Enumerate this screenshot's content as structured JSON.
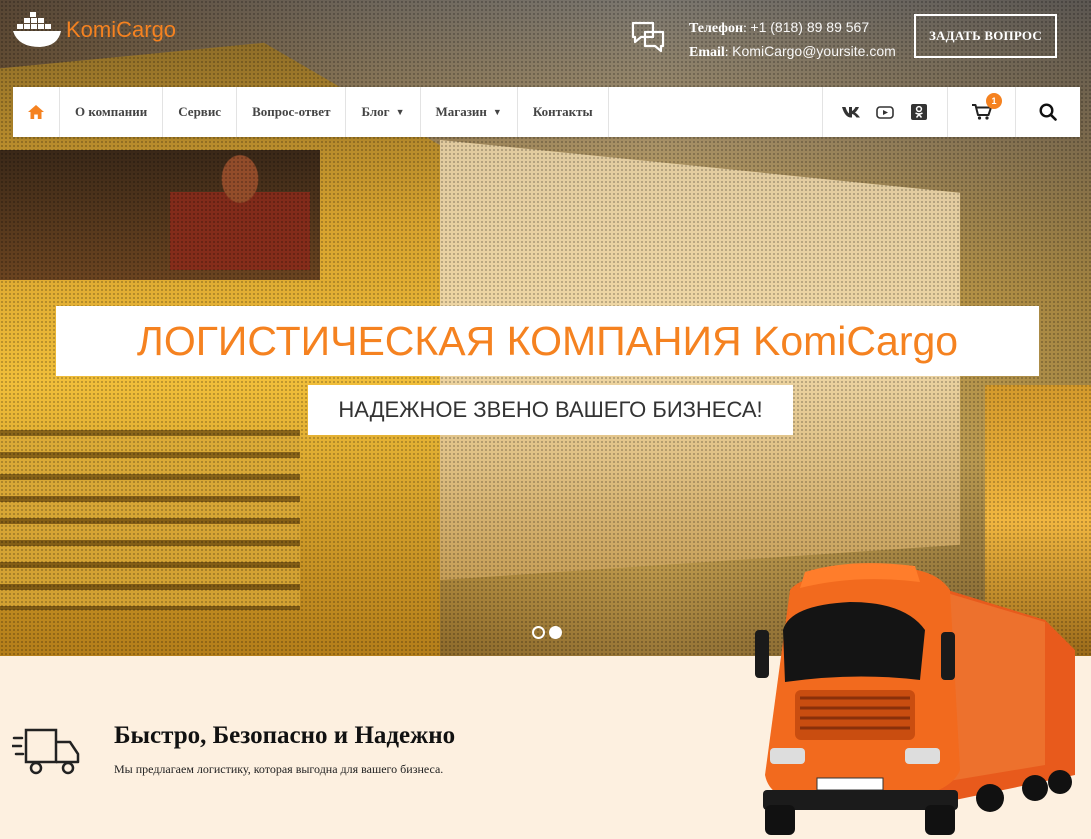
{
  "header": {
    "logo_text": "KomiCargo",
    "phone_label": "Телефон",
    "phone_value": "+1 (818) 89 89 567",
    "email_label": "Email",
    "email_value": "KomiCargo@yoursite.com",
    "ask_button": "ЗАДАТЬ ВОПРОС"
  },
  "nav": {
    "items": [
      {
        "label": "О компании"
      },
      {
        "label": "Сервис"
      },
      {
        "label": "Вопрос-ответ"
      },
      {
        "label": "Блог"
      },
      {
        "label": "Магазин"
      },
      {
        "label": "Контакты"
      }
    ],
    "cart_count": "1",
    "social": [
      "vk-icon",
      "youtube-icon",
      "odnoklassniki-icon"
    ]
  },
  "hero": {
    "title": "ЛОГИСТИЧЕСКАЯ КОМПАНИЯ KomiCargo",
    "subtitle": "НАДЕЖНОЕ ЗВЕНО ВАШЕГО БИЗНЕСА!",
    "slides": 2,
    "active_slide": 2
  },
  "feature": {
    "title": "Быстро, Безопасно и Надежно",
    "description": "Мы предлагаем логистику, которая выгодна для вашего бизнеса."
  },
  "colors": {
    "accent": "#f58220",
    "nav_bg": "#ffffff",
    "feature_bg": "#fdf0e0"
  }
}
